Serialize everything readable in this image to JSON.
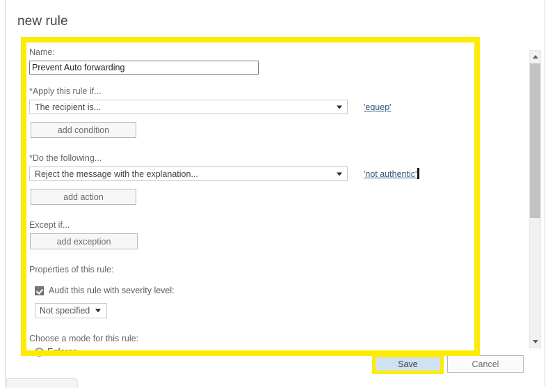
{
  "page": {
    "title": "new rule"
  },
  "form": {
    "name_label": "Name:",
    "name_value": "Prevent Auto forwarding",
    "name_placeholder": "",
    "apply_label": "*Apply this rule if...",
    "apply_condition_selected": "The recipient is...",
    "apply_condition_value_link": "'equep'",
    "add_condition_label": "add condition",
    "do_label": "*Do the following...",
    "do_action_selected": "Reject the message with the explanation...",
    "do_action_value_link": "'not authentic'",
    "add_action_label": "add action",
    "except_label": "Except if...",
    "add_exception_label": "add exception",
    "properties_label": "Properties of this rule:",
    "audit_checkbox_label": "Audit this rule with severity level:",
    "audit_checkbox_checked": true,
    "severity_selected": "Not specified",
    "mode_label": "Choose a mode for this rule:",
    "mode_option_enforce": "Enforce",
    "mode_enforce_selected": true
  },
  "footer": {
    "save_label": "Save",
    "cancel_label": "Cancel"
  },
  "scrollbar": {
    "up_arrow": "scroll-up-arrow",
    "down_arrow": "scroll-down-arrow"
  },
  "colors": {
    "highlight_yellow": "#fdeb03",
    "save_button_blue": "#cfe2f3",
    "link_blue": "#31557a"
  }
}
